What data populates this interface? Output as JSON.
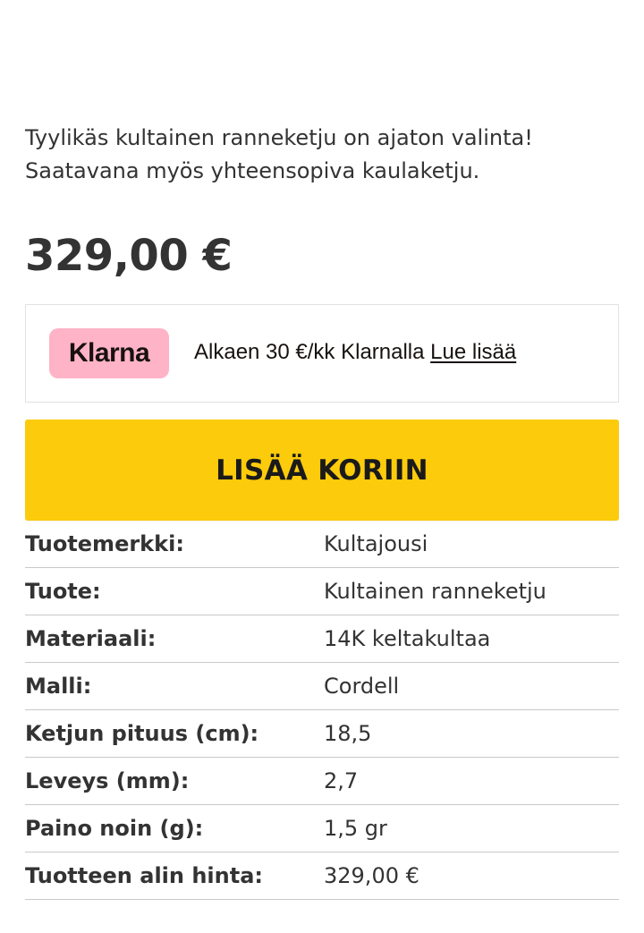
{
  "description": {
    "line1": "Tyylikäs kultainen ranneketju on ajaton valinta!",
    "line2": "Saatavana myös yhteensopiva kaulaketju."
  },
  "price": "329,00 €",
  "klarna": {
    "logo_text": "Klarna",
    "message": "Alkaen 30 €/kk Klarnalla ",
    "link_label": "Lue lisää",
    "badge_color": "#ffb3c7"
  },
  "add_to_cart": {
    "label": "LISÄÄ KORIIN",
    "color": "#fccb0b"
  },
  "specs": [
    {
      "label": "Tuotemerkki:",
      "value": "Kultajousi"
    },
    {
      "label": "Tuote:",
      "value": "Kultainen ranneketju"
    },
    {
      "label": "Materiaali:",
      "value": "14K keltakultaa"
    },
    {
      "label": "Malli:",
      "value": "Cordell"
    },
    {
      "label": "Ketjun pituus (cm):",
      "value": "18,5"
    },
    {
      "label": "Leveys (mm):",
      "value": "2,7"
    },
    {
      "label": "Paino noin (g):",
      "value": "1,5 gr"
    },
    {
      "label": "Tuotteen alin hinta:",
      "value": "329,00 €"
    }
  ]
}
